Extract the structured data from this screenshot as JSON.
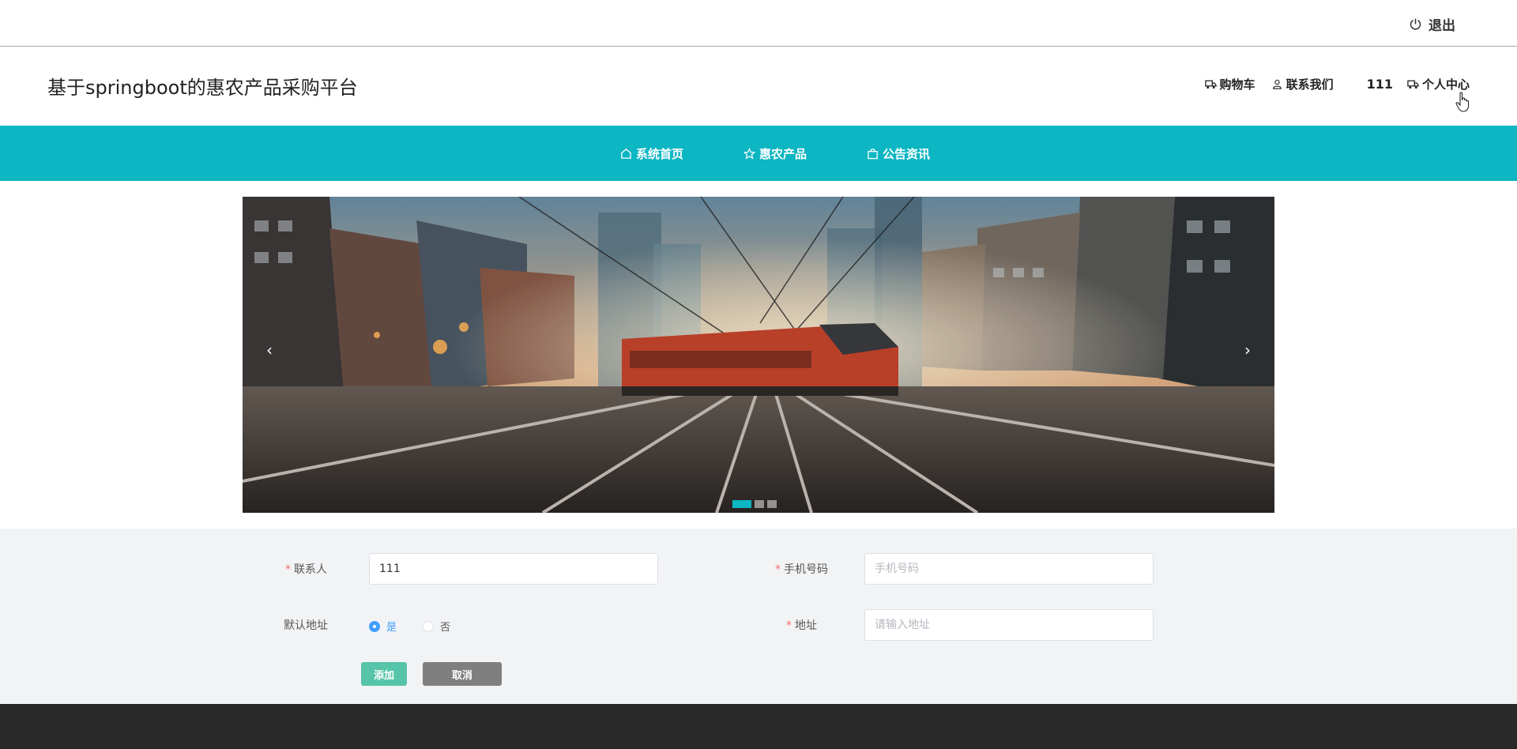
{
  "topbar": {
    "logout_label": "退出"
  },
  "header": {
    "site_title": "基于springboot的惠农产品采购平台",
    "cart_label": "购物车",
    "contact_label": "联系我们",
    "username": "111",
    "profile_label": "个人中心"
  },
  "nav": {
    "items": [
      {
        "label": "系统首页",
        "icon": "home-icon"
      },
      {
        "label": "惠农产品",
        "icon": "star-icon"
      },
      {
        "label": "公告资讯",
        "icon": "bag-icon"
      }
    ],
    "color": "#0cb6c2"
  },
  "carousel": {
    "prev_label": "‹",
    "next_label": "›",
    "slide_count": 3,
    "active_index": 0
  },
  "form": {
    "contact": {
      "label": "联系人",
      "value": "111",
      "required": true
    },
    "phone": {
      "label": "手机号码",
      "placeholder": "手机号码",
      "value": "",
      "required": true
    },
    "default_address": {
      "label": "默认地址",
      "options": [
        "是",
        "否"
      ],
      "selected": "是"
    },
    "address": {
      "label": "地址",
      "placeholder": "请输入地址",
      "value": "",
      "required": true
    },
    "add_button": "添加",
    "cancel_button": "取消"
  }
}
